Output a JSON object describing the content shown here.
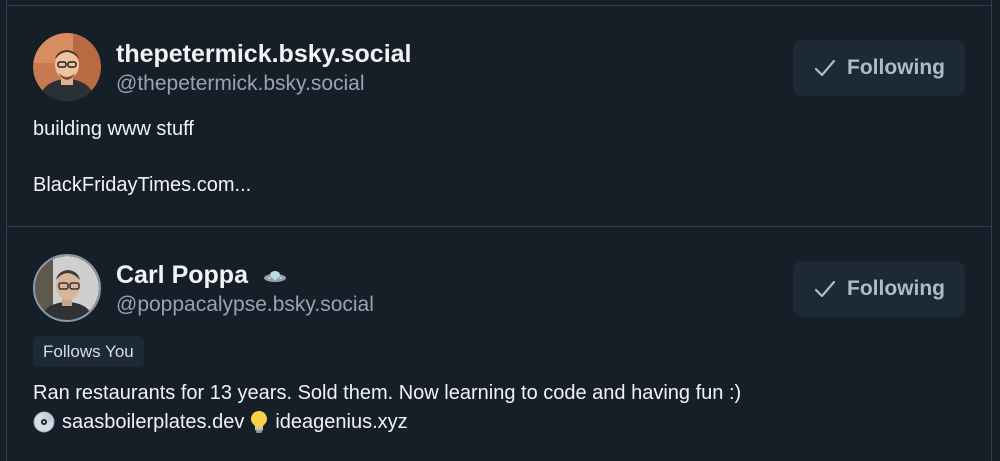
{
  "profiles": [
    {
      "display_name": "thepetermick.bsky.social",
      "handle": "@thepetermick.bsky.social",
      "follow_label": "Following",
      "bio_line1": "building www stuff",
      "bio_line2": "BlackFridayTimes.com..."
    },
    {
      "display_name": "Carl Poppa",
      "handle": "@poppacalypse.bsky.social",
      "follow_label": "Following",
      "badge": "Follows You",
      "bio_line1": "Ran restaurants for 13 years. Sold them. Now learning to code and having fun :)",
      "bio_link1": "saasboilerplates.dev",
      "bio_link2": "ideagenius.xyz"
    }
  ],
  "icons": {
    "check": "check-icon",
    "ufo": "ufo-icon",
    "disc": "disc-icon",
    "lightbulb": "lightbulb-icon"
  },
  "colors": {
    "background": "#161e27",
    "border": "#2e4052",
    "button_bg": "#1e2937",
    "handle_text": "#93a4b6",
    "button_text": "#aebbc9"
  }
}
